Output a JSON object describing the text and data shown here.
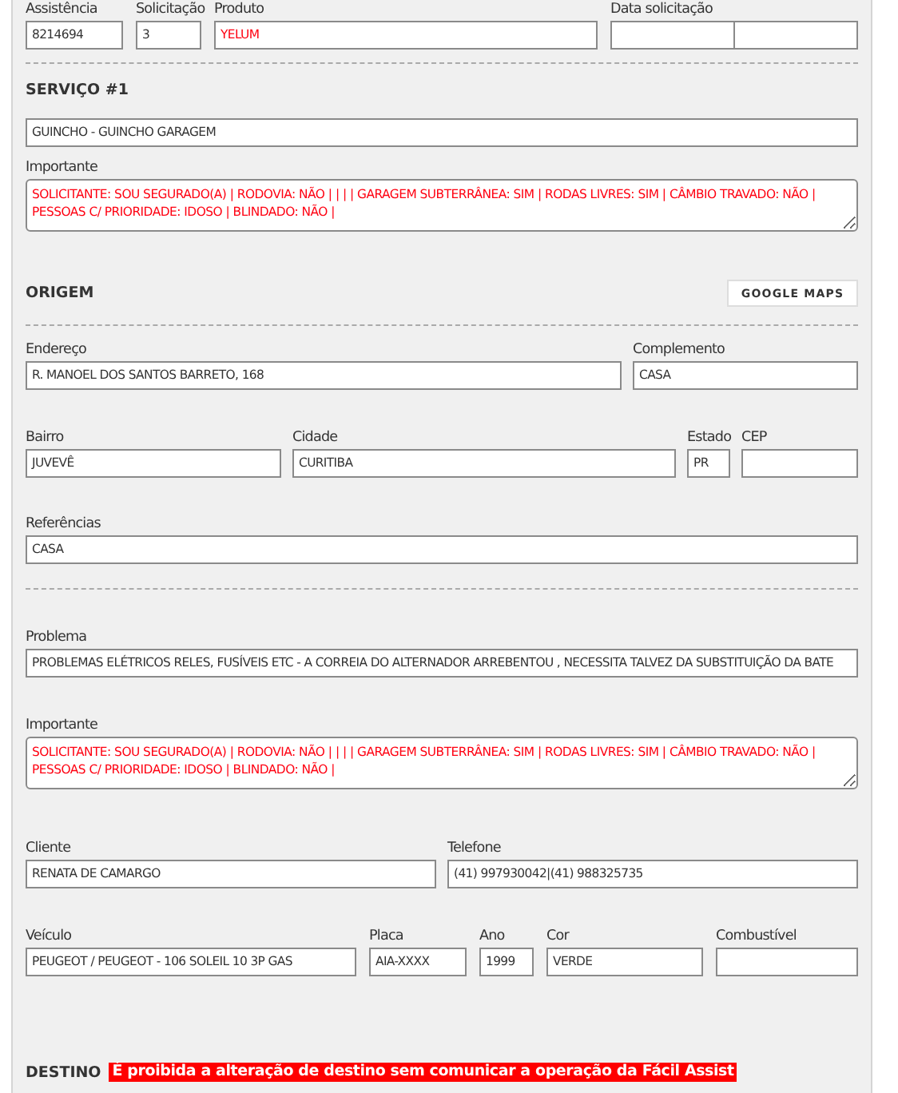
{
  "blocks": [
    {
      "kind": "row",
      "fields": [
        {
          "kind": "input",
          "label": "Assistência",
          "value": "8214694",
          "alert": false
        },
        {
          "kind": "input",
          "label": "Solicitação",
          "value": "3",
          "alert": false
        },
        {
          "kind": "input",
          "label": "Produto",
          "value": "YELUM",
          "alert": true
        },
        {
          "kind": "split",
          "label": "Data solicitação"
        }
      ]
    },
    {
      "kind": "divider"
    },
    {
      "kind": "heading",
      "title": "SERVIÇO #1"
    },
    {
      "kind": "row",
      "fields": [
        {
          "kind": "input",
          "value": "GUINCHO - GUINCHO GARAGEM",
          "alert": false
        }
      ]
    },
    {
      "kind": "row",
      "fields": [
        {
          "kind": "textarea",
          "label": "Importante",
          "value": "SOLICITANTE: SOU SEGURADO(A) | RODOVIA: NÃO |  |  |  | GARAGEM SUBTERRÂNEA: SIM | RODAS LIVRES: SIM | CÂMBIO TRAVADO: NÃO | PESSOAS C/ PRIORIDADE: IDOSO | BLINDADO: NÃO |",
          "alert": true
        }
      ]
    },
    {
      "kind": "heading",
      "title": "ORIGEM",
      "button": "GOOGLE MAPS"
    },
    {
      "kind": "divider"
    },
    {
      "kind": "row",
      "fields": [
        {
          "kind": "input",
          "label": "Endereço",
          "value": "R. MANOEL DOS SANTOS BARRETO, 168",
          "alert": false
        },
        {
          "kind": "input",
          "label": "Complemento",
          "value": "CASA",
          "alert": false
        }
      ]
    },
    {
      "kind": "row",
      "fields": [
        {
          "kind": "input",
          "label": "Bairro",
          "value": "JUVEVÊ",
          "alert": false
        },
        {
          "kind": "input",
          "label": "Cidade",
          "value": "CURITIBA",
          "alert": false
        },
        {
          "kind": "input",
          "label": "Estado",
          "value": "PR",
          "alert": false
        },
        {
          "kind": "input",
          "label": "CEP"
        }
      ]
    },
    {
      "kind": "row",
      "fields": [
        {
          "kind": "input",
          "label": "Referências",
          "value": "CASA",
          "alert": false
        }
      ]
    },
    {
      "kind": "divider"
    },
    {
      "kind": "row",
      "fields": [
        {
          "kind": "input",
          "label": "Problema",
          "value": "PROBLEMAS ELÉTRICOS RELES, FUSÍVEIS ETC - A CORREIA DO ALTERNADOR ARREBENTOU , NECESSITA TALVEZ DA SUBSTITUIÇÃO DA BATE",
          "alert": false
        }
      ]
    },
    {
      "kind": "row",
      "fields": [
        {
          "kind": "textarea",
          "label": "Importante",
          "value": "SOLICITANTE: SOU SEGURADO(A) | RODOVIA: NÃO |  |  |  | GARAGEM SUBTERRÂNEA: SIM | RODAS LIVRES: SIM | CÂMBIO TRAVADO: NÃO | PESSOAS C/ PRIORIDADE: IDOSO | BLINDADO: NÃO |",
          "alert": true
        }
      ]
    },
    {
      "kind": "row",
      "fields": [
        {
          "kind": "input",
          "label": "Cliente",
          "value": "RENATA DE CAMARGO",
          "alert": false
        },
        {
          "kind": "input",
          "label": "Telefone",
          "value": "(41) 997930042|(41) 988325735",
          "alert": false
        }
      ]
    },
    {
      "kind": "row",
      "fields": [
        {
          "kind": "input",
          "label": "Veículo",
          "value": "PEUGEOT / PEUGEOT - 106 SOLEIL 10 3P GAS",
          "alert": false
        },
        {
          "kind": "input",
          "label": "Placa",
          "value": "AIA-XXXX",
          "alert": false
        },
        {
          "kind": "input",
          "label": "Ano",
          "value": "1999",
          "alert": false
        },
        {
          "kind": "input",
          "label": "Cor",
          "value": "VERDE",
          "alert": false
        },
        {
          "kind": "input",
          "label": "Combustível"
        }
      ]
    },
    {
      "kind": "heading",
      "title": "DESTINO",
      "notice": "É proibida a alteração de destino sem comunicar a operação da Fácil Assist"
    }
  ]
}
